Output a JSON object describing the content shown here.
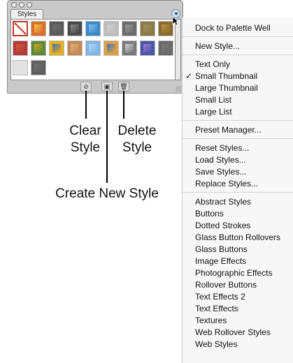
{
  "palette": {
    "tab_label": "Styles",
    "swatches": [
      {
        "name": "swatch-no-style",
        "fill": "#ffffff",
        "mark": "#c0392b"
      },
      {
        "name": "swatch-1",
        "fill": "#d9702a",
        "mark": "#f5c14a"
      },
      {
        "name": "swatch-2",
        "fill": "#5a5a5a",
        "mark": "#6b6b6b"
      },
      {
        "name": "swatch-3",
        "fill": "#4a4a4a",
        "mark": "#888888"
      },
      {
        "name": "swatch-4",
        "fill": "#3b88c8",
        "mark": "#7ec3ef"
      },
      {
        "name": "swatch-5",
        "fill": "#bdbdbd",
        "mark": "#cfcfcf"
      },
      {
        "name": "swatch-6",
        "fill": "#6b6b6b",
        "mark": "#9a9a9a"
      },
      {
        "name": "swatch-7",
        "fill": "#8a7a4a",
        "mark": "#a08f5c"
      },
      {
        "name": "swatch-8",
        "fill": "#8b6a2e",
        "mark": "#b59244"
      },
      {
        "name": "swatch-9",
        "fill": "#b23a3a",
        "mark": "#d05a3a"
      },
      {
        "name": "swatch-10",
        "fill": "#5c8a3a",
        "mark": "#d4a020"
      },
      {
        "name": "swatch-11",
        "fill": "#e2b020",
        "mark": "#4a6fb0"
      },
      {
        "name": "swatch-12",
        "fill": "#c28a52",
        "mark": "#e0b07a"
      },
      {
        "name": "swatch-13",
        "fill": "#7fb6e6",
        "mark": "#b3d8f5"
      },
      {
        "name": "swatch-14",
        "fill": "#e0a040",
        "mark": "#3b78c0"
      },
      {
        "name": "swatch-15",
        "fill": "#7a7a7a",
        "mark": "#d0d0d0"
      },
      {
        "name": "swatch-16",
        "fill": "#4a56a8",
        "mark": "#9a7ad0"
      },
      {
        "name": "swatch-17",
        "fill": "#6a6a6a",
        "mark": "#7a7a7a"
      },
      {
        "name": "swatch-18",
        "fill": "#e2e2e2",
        "mark": "#e2e2e2"
      },
      {
        "name": "swatch-19",
        "fill": "#5e5e5e",
        "mark": "#707070"
      }
    ],
    "buttons": [
      {
        "name": "clear-style-button",
        "glyph": "⊘"
      },
      {
        "name": "create-new-style-button",
        "glyph": "▣"
      },
      {
        "name": "delete-style-button",
        "glyph": "🗑"
      }
    ]
  },
  "callouts": {
    "clear_style": [
      "Clear",
      "Style"
    ],
    "delete_style": [
      "Delete",
      "Style"
    ],
    "create_new_style": "Create New Style"
  },
  "menu": {
    "groups": [
      [
        {
          "label": "Dock to Palette Well"
        }
      ],
      [
        {
          "label": "New Style..."
        }
      ],
      [
        {
          "label": "Text Only"
        },
        {
          "label": "Small Thumbnail",
          "checked": true
        },
        {
          "label": "Large Thumbnail"
        },
        {
          "label": "Small List"
        },
        {
          "label": "Large List"
        }
      ],
      [
        {
          "label": "Preset Manager..."
        }
      ],
      [
        {
          "label": "Reset Styles..."
        },
        {
          "label": "Load Styles..."
        },
        {
          "label": "Save Styles..."
        },
        {
          "label": "Replace Styles..."
        }
      ],
      [
        {
          "label": "Abstract Styles"
        },
        {
          "label": "Buttons"
        },
        {
          "label": "Dotted Strokes"
        },
        {
          "label": "Glass Button Rollovers"
        },
        {
          "label": "Glass Buttons"
        },
        {
          "label": "Image Effects"
        },
        {
          "label": "Photographic Effects"
        },
        {
          "label": "Rollover Buttons"
        },
        {
          "label": "Text Effects 2"
        },
        {
          "label": "Text Effects"
        },
        {
          "label": "Textures"
        },
        {
          "label": "Web Rollover Styles"
        },
        {
          "label": "Web Styles"
        }
      ]
    ],
    "check_glyph": "✓"
  },
  "icons": {
    "palette_menu": "palette-menu-arrow-icon",
    "cursor": "arrow-cursor-icon"
  }
}
